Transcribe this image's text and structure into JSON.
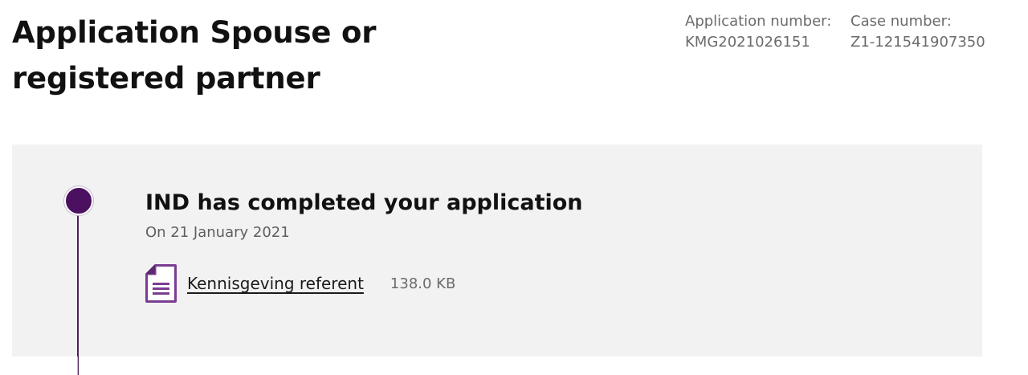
{
  "header": {
    "title": "Application Spouse or registered partner",
    "application_number_label": "Application number:",
    "application_number_value": "KMG2021026151",
    "case_number_label": "Case number:",
    "case_number_value": "Z1-121541907350"
  },
  "timeline": {
    "accent_color": "#4b1160",
    "events": [
      {
        "title": "IND has completed your application",
        "date": "On 21 January 2021",
        "document": {
          "icon": "document-icon",
          "label": "Kennisgeving referent",
          "size": "138.0 KB"
        }
      }
    ]
  }
}
